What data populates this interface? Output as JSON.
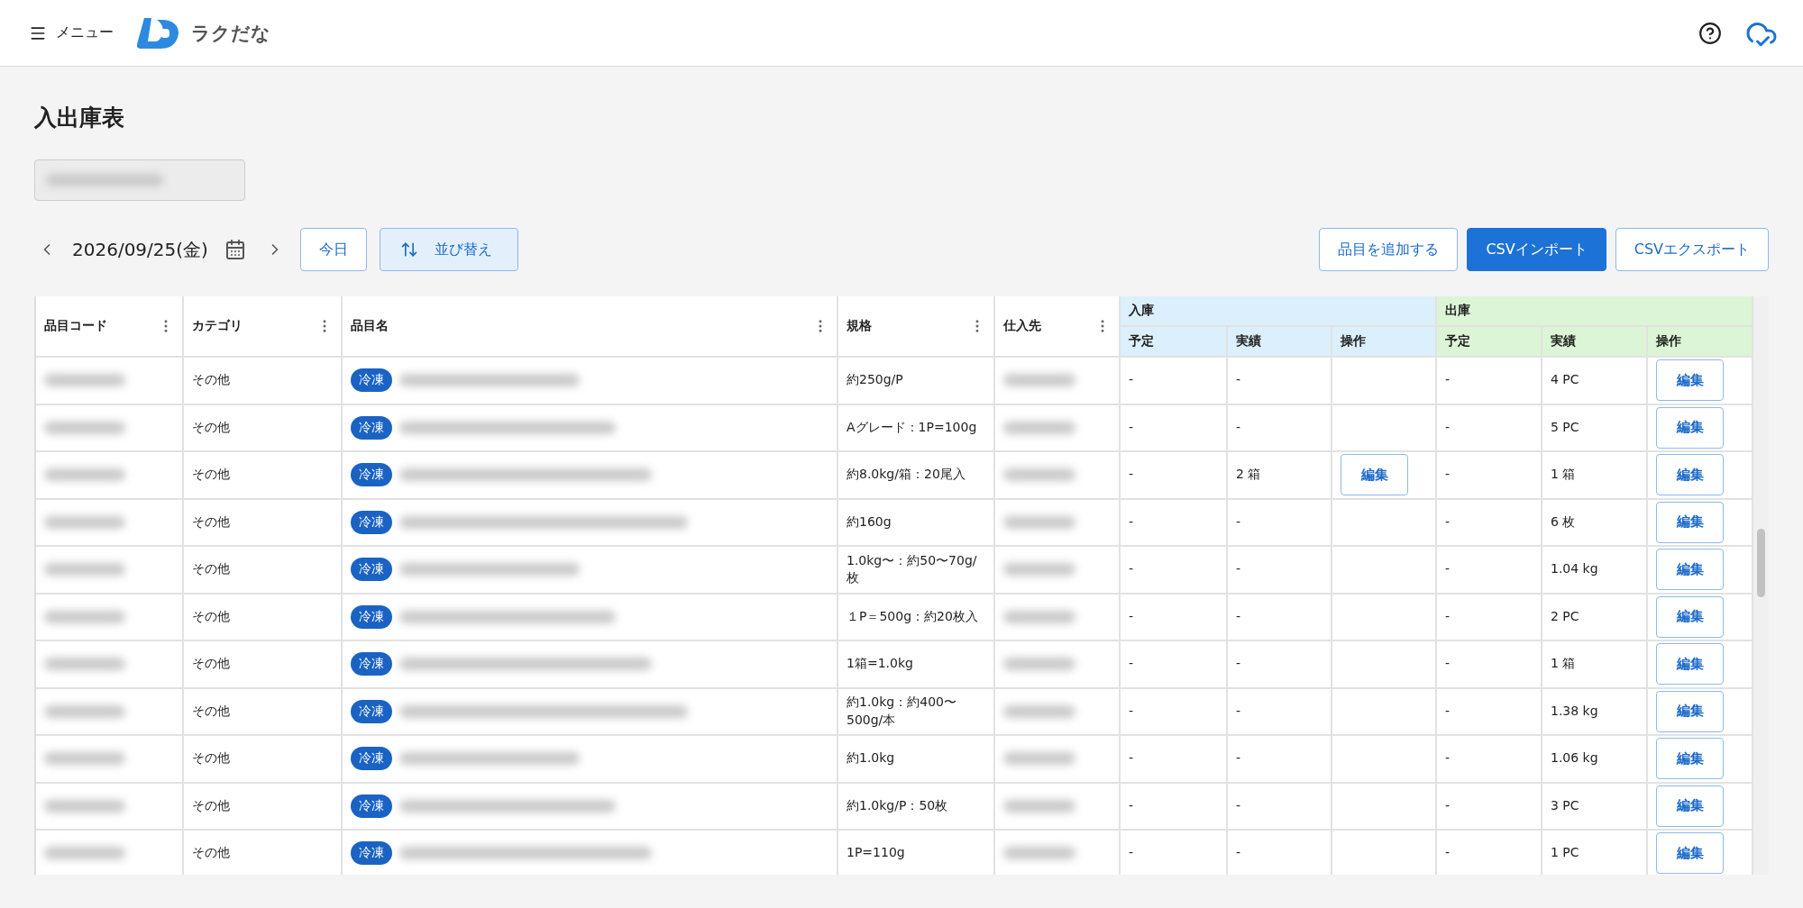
{
  "header": {
    "menu_label": "メニュー",
    "logo_text": "ラクだな"
  },
  "page_title": "入出庫表",
  "toolbar": {
    "date": "2026/09/25(金)",
    "today": "今日",
    "sort": "並び替え",
    "actions": [
      {
        "label": "品目を追加する",
        "kind": "outline"
      },
      {
        "label": "CSVインポート",
        "kind": "primary"
      },
      {
        "label": "CSVエクスポート",
        "kind": "outline"
      }
    ]
  },
  "table": {
    "columns": [
      "品目コード",
      "カテゴリ",
      "品目名",
      "規格",
      "仕入先"
    ],
    "groups": [
      {
        "label": "入庫",
        "subcolumns": [
          "予定",
          "実績",
          "操作"
        ],
        "color": "#dbeffc"
      },
      {
        "label": "出庫",
        "subcolumns": [
          "予定",
          "実績",
          "操作"
        ],
        "color": "#dcf5d6"
      }
    ],
    "rows": [
      {
        "category": "その他",
        "tag": "冷凍",
        "spec": "約250g/P",
        "in_plan": "-",
        "in_actual": "-",
        "out_plan": "-",
        "out_actual": "4 PC",
        "out_action": "編集"
      },
      {
        "category": "その他",
        "tag": "冷凍",
        "spec": "Aグレード：1P=100g",
        "in_plan": "-",
        "in_actual": "-",
        "out_plan": "-",
        "out_actual": "5 PC",
        "out_action": "編集"
      },
      {
        "category": "その他",
        "tag": "冷凍",
        "spec": "約8.0kg/箱：20尾入",
        "in_plan": "-",
        "in_actual": "2 箱",
        "in_action": "編集",
        "out_plan": "-",
        "out_actual": "1 箱",
        "out_action": "編集"
      },
      {
        "category": "その他",
        "tag": "冷凍",
        "spec": "約160g",
        "in_plan": "-",
        "in_actual": "-",
        "out_plan": "-",
        "out_actual": "6 枚",
        "out_action": "編集"
      },
      {
        "category": "その他",
        "tag": "冷凍",
        "spec": "1.0kg〜：約50〜70g/枚",
        "in_plan": "-",
        "in_actual": "-",
        "out_plan": "-",
        "out_actual": "1.04 kg",
        "out_action": "編集"
      },
      {
        "category": "その他",
        "tag": "冷凍",
        "spec": "１P＝500g：約20枚入",
        "in_plan": "-",
        "in_actual": "-",
        "out_plan": "-",
        "out_actual": "2 PC",
        "out_action": "編集"
      },
      {
        "category": "その他",
        "tag": "冷凍",
        "spec": "1箱=1.0kg",
        "in_plan": "-",
        "in_actual": "-",
        "out_plan": "-",
        "out_actual": "1 箱",
        "out_action": "編集"
      },
      {
        "category": "その他",
        "tag": "冷凍",
        "spec": "約1.0kg：約400〜500g/本",
        "in_plan": "-",
        "in_actual": "-",
        "out_plan": "-",
        "out_actual": "1.38 kg",
        "out_action": "編集"
      },
      {
        "category": "その他",
        "tag": "冷凍",
        "spec": "約1.0kg",
        "in_plan": "-",
        "in_actual": "-",
        "out_plan": "-",
        "out_actual": "1.06 kg",
        "out_action": "編集"
      },
      {
        "category": "その他",
        "tag": "冷凍",
        "spec": "約1.0kg/P：50枚",
        "in_plan": "-",
        "in_actual": "-",
        "out_plan": "-",
        "out_actual": "3 PC",
        "out_action": "編集"
      },
      {
        "category": "その他",
        "tag": "冷凍",
        "spec": "1P=110g",
        "in_plan": "-",
        "in_actual": "-",
        "out_plan": "-",
        "out_actual": "1 PC",
        "out_action": "編集"
      }
    ]
  }
}
